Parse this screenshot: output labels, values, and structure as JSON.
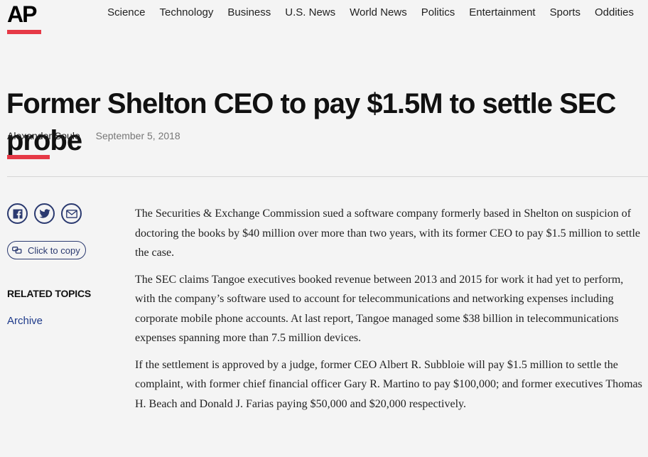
{
  "header": {
    "logo_text": "AP",
    "brand_color": "#e63946",
    "nav": [
      "Science",
      "Technology",
      "Business",
      "U.S. News",
      "World News",
      "Politics",
      "Entertainment",
      "Sports",
      "Oddities"
    ]
  },
  "article": {
    "headline": "Former Shelton CEO to pay $1.5M to settle SEC probe",
    "author": "Alexander Soule",
    "date": "September 5, 2018",
    "paragraphs": [
      "The Securities & Exchange Commission sued a software company formerly based in Shelton on suspicion of doctoring the books by $40 million over more than two years, with its former CEO to pay $1.5 million to settle the case.",
      "The SEC claims Tangoe executives booked revenue between 2013 and 2015 for work it had yet to perform, with the company’s software used to account for telecommunications and networking expenses including corporate mobile phone accounts. At last report, Tangoe managed some $38 billion in telecommunications expenses spanning more than 7.5 million devices.",
      "If the settlement is approved by a judge, former CEO Albert R. Subbloie will pay $1.5 million to settle the complaint, with former chief financial officer Gary R. Martino to pay $100,000; and former executives Thomas H. Beach and Donald J. Farias paying $50,000 and $20,000 respectively."
    ]
  },
  "sidebar": {
    "share_icons": [
      "facebook-icon",
      "twitter-icon",
      "email-icon"
    ],
    "copy_label": "Click to copy",
    "related_topics_title": "RELATED TOPICS",
    "related_topics": [
      "Archive"
    ]
  }
}
